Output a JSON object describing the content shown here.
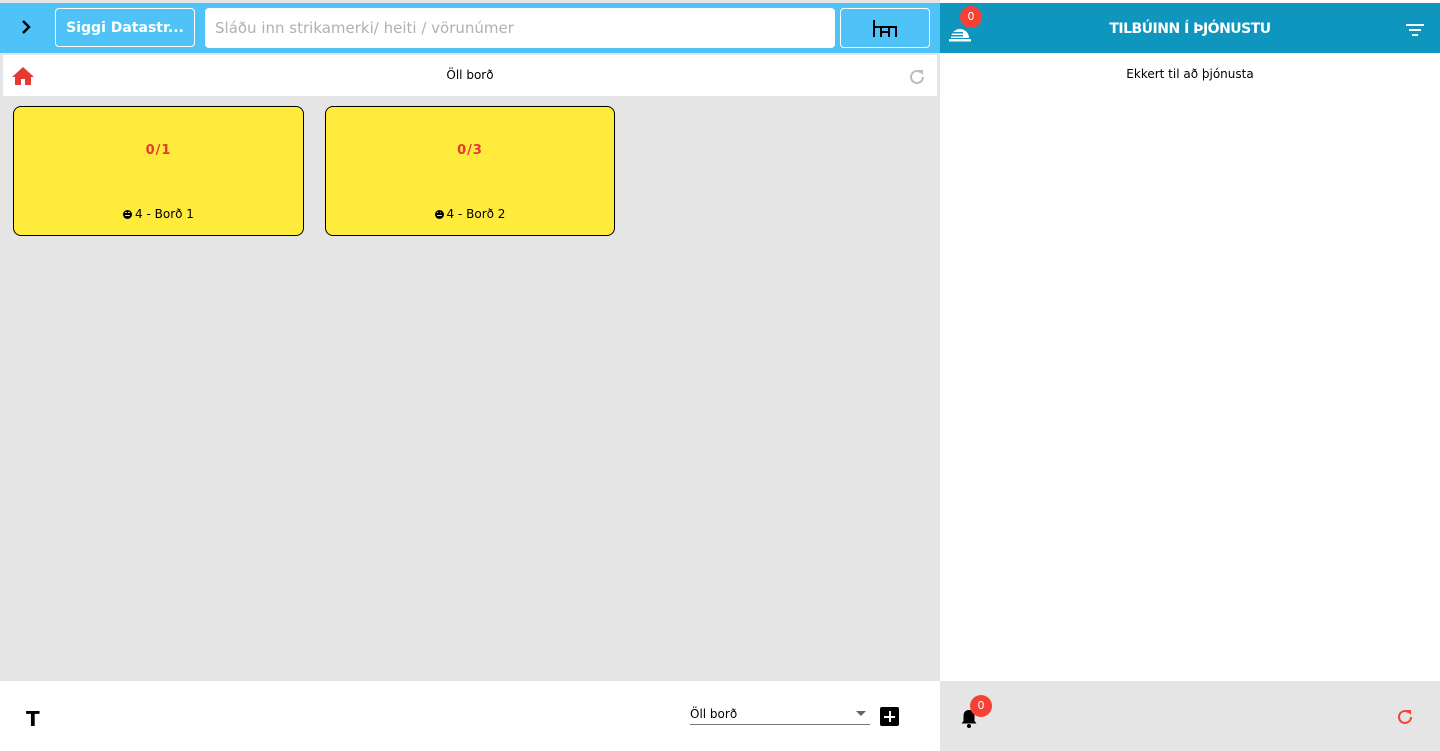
{
  "topbar": {
    "user_button_label": "Siggi Datastr...",
    "search_placeholder": "Sláðu inn strikamerki/ heiti / vörunúmer"
  },
  "subbar": {
    "title": "Öll borð"
  },
  "tables": [
    {
      "count": "0/1",
      "label": "4 - Borð 1"
    },
    {
      "count": "0/3",
      "label": "4 - Borð 2"
    }
  ],
  "bottombar": {
    "t_label": "T",
    "select_value": "Öll borð"
  },
  "right_panel": {
    "title": "TILBÚINN Í ÞJÓNUSTU",
    "serving_badge": "0",
    "empty_text": "Ekkert til að þjónusta",
    "notification_badge": "0"
  },
  "colors": {
    "topbar": "#4fc3f7",
    "right_header": "#0f96bf",
    "card": "#ffeb3b",
    "accent_red": "#e53935"
  }
}
